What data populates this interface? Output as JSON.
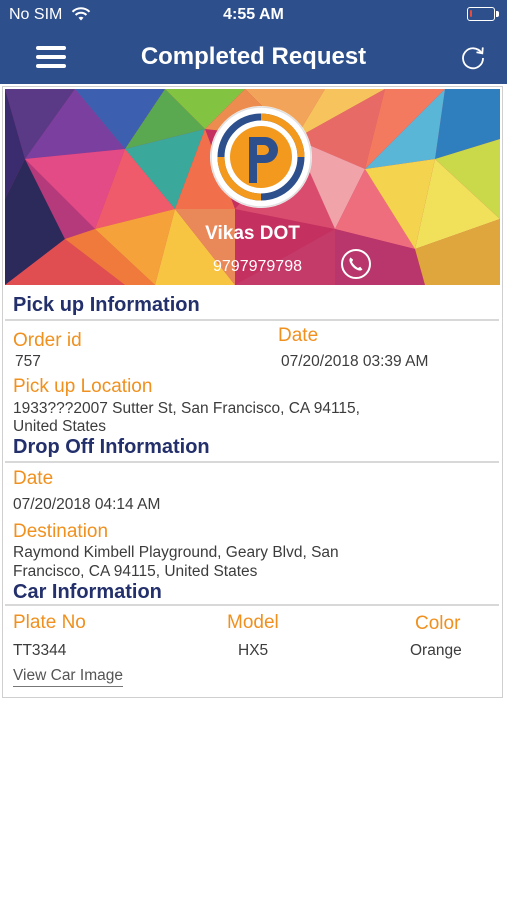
{
  "status_bar": {
    "carrier": "No SIM",
    "time": "4:55 AM",
    "battery_level": 0.1,
    "battery_color": "#e74c3c"
  },
  "nav": {
    "title": "Completed Request",
    "menu_icon": "hamburger-menu-icon",
    "refresh_icon": "refresh-icon"
  },
  "driver": {
    "name": "Vikas DOT",
    "phone": "9797979798",
    "call_icon": "phone-icon"
  },
  "pickup": {
    "title": "Pick up Information",
    "order_id_label": "Order id",
    "order_id": "757",
    "date_label": "Date",
    "date": "07/20/2018 03:39 AM",
    "location_label": "Pick up Location",
    "location_line1": "1933???2007 Sutter St, San Francisco, CA  94115,",
    "location_line2": "United States"
  },
  "dropoff": {
    "title": "Drop Off Information",
    "date_label": "Date",
    "date": "07/20/2018 04:14 AM",
    "destination_label": "Destination",
    "destination_line1": "Raymond Kimbell Playground, Geary Blvd, San",
    "destination_line2": "Francisco, CA  94115, United States"
  },
  "car": {
    "title": "Car Information",
    "plate_label": "Plate No",
    "plate": "TT3344",
    "model_label": "Model",
    "model": "HX5",
    "color_label": "Color",
    "color": "Orange",
    "view_image_link": "View Car Image"
  },
  "colors": {
    "nav_background": "#2d4f8c",
    "section_title": "#23306b",
    "label": "#f0901e",
    "logo_orange": "#f39a1e",
    "logo_blue": "#2d4f8c"
  }
}
